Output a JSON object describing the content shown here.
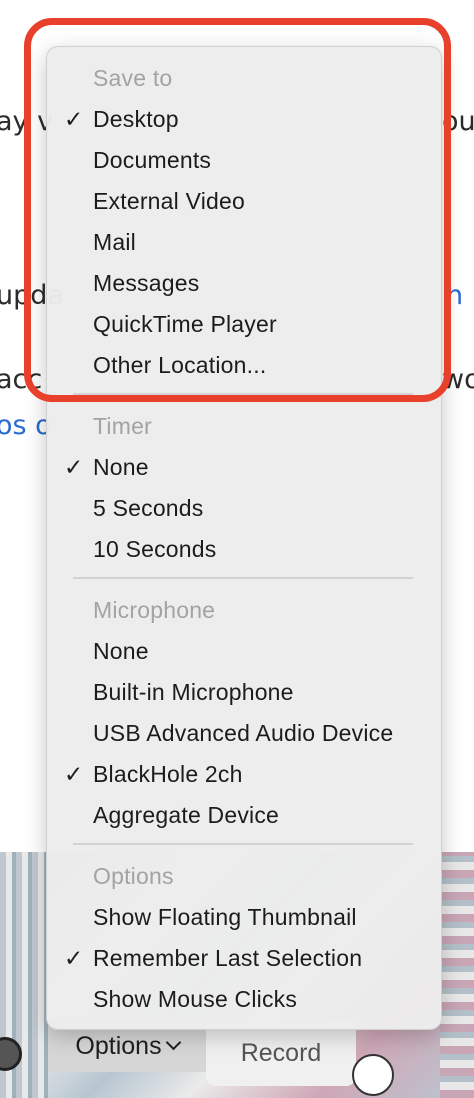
{
  "background_fragments": [
    {
      "text": "ay v",
      "link": false
    },
    {
      "text": "ou",
      "link": false
    },
    {
      "text": "upda",
      "link": false
    },
    {
      "text": "n",
      "link": true
    },
    {
      "text": "acc",
      "link": false
    },
    {
      "text": "wo",
      "link": false
    },
    {
      "text": "os o",
      "link": true
    }
  ],
  "menu": {
    "save_to": {
      "header": "Save to",
      "items": [
        {
          "label": "Desktop",
          "checked": true
        },
        {
          "label": "Documents",
          "checked": false
        },
        {
          "label": "External Video",
          "checked": false
        },
        {
          "label": "Mail",
          "checked": false
        },
        {
          "label": "Messages",
          "checked": false
        },
        {
          "label": "QuickTime Player",
          "checked": false
        },
        {
          "label": "Other Location...",
          "checked": false
        }
      ]
    },
    "timer": {
      "header": "Timer",
      "items": [
        {
          "label": "None",
          "checked": true
        },
        {
          "label": "5 Seconds",
          "checked": false
        },
        {
          "label": "10 Seconds",
          "checked": false
        }
      ]
    },
    "microphone": {
      "header": "Microphone",
      "items": [
        {
          "label": "None",
          "checked": false
        },
        {
          "label": "Built-in Microphone",
          "checked": false
        },
        {
          "label": "USB Advanced Audio Device",
          "checked": false
        },
        {
          "label": "BlackHole 2ch",
          "checked": true
        },
        {
          "label": "Aggregate Device",
          "checked": false
        }
      ]
    },
    "options": {
      "header": "Options",
      "items": [
        {
          "label": "Show Floating Thumbnail",
          "checked": false
        },
        {
          "label": "Remember Last Selection",
          "checked": true
        },
        {
          "label": "Show Mouse Clicks",
          "checked": false
        }
      ]
    },
    "check_glyph": "✓"
  },
  "toolbar": {
    "options_label": "Options",
    "record_label": "Record"
  },
  "colors": {
    "highlight": "#e8402a",
    "header_text": "#a3a3a3",
    "link": "#2a6bd1"
  }
}
